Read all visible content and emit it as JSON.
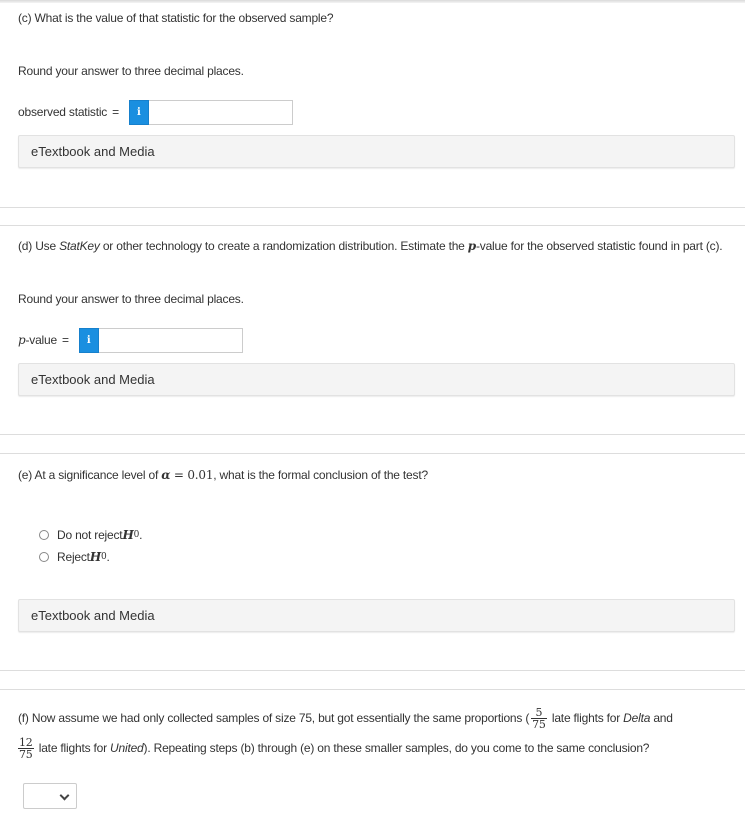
{
  "part_c": {
    "question": "(c) What is the value of that statistic for the observed sample?",
    "instruction": "Round your answer to three decimal places.",
    "answer_label": "observed statistic",
    "equals": "=",
    "info_icon": "i",
    "answer_value": "",
    "etextbook_label": "eTextbook and Media"
  },
  "part_d": {
    "question_prefix": "(d) Use ",
    "question_italic": "StatKey",
    "question_mid": " or other technology to create a randomization distribution. Estimate the ",
    "question_p": "p",
    "question_suffix": "-value for the observed statistic found in part (c).",
    "instruction": "Round your answer to three decimal places.",
    "answer_label_p": "p",
    "answer_label_rest": "-value",
    "equals": "=",
    "info_icon": "i",
    "answer_value": "",
    "etextbook_label": "eTextbook and Media"
  },
  "part_e": {
    "question_prefix": "(e) At a significance level of ",
    "alpha": "α",
    "equals": " = ",
    "alpha_value": "0.01",
    "question_suffix": ", what is the formal conclusion of the test?",
    "options": [
      {
        "label": "Do not reject ",
        "hyp": "H",
        "sub": "0",
        "end": ".",
        "selected": false
      },
      {
        "label": "Reject ",
        "hyp": "H",
        "sub": "0",
        "end": ".",
        "selected": false
      }
    ],
    "etextbook_label": "eTextbook and Media"
  },
  "part_f": {
    "text1": "(f) Now assume we had only collected samples of size 75, but got essentially the same proportions (",
    "frac1_num": "5",
    "frac1_den": "75",
    "text2": " late flights for ",
    "delta": "Delta",
    "text3": " and",
    "frac2_num": "12",
    "frac2_den": "75",
    "text4": " late flights for ",
    "united": "United",
    "text5": "). Repeating steps (b) through (e) on these smaller samples, do you come to the same conclusion?",
    "select_value": ""
  },
  "colors": {
    "info_button": "#1a8fe0",
    "etextbook_bg": "#f4f4f4",
    "separator": "#dddddd",
    "text": "#333333"
  }
}
